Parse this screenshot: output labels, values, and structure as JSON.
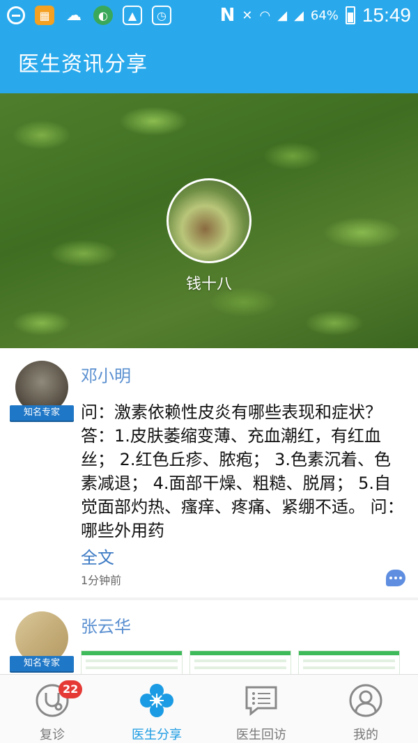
{
  "status_bar": {
    "signal_label": "N",
    "battery_percent": "64%",
    "time": "15:49"
  },
  "app_bar": {
    "title": "医生资讯分享"
  },
  "profile": {
    "name": "钱十八"
  },
  "posts": [
    {
      "author": "邓小明",
      "badge": "知名专家",
      "content": "问：激素依赖性皮炎有哪些表现和症状？ 答：1.皮肤萎缩变薄、充血潮红，有红血丝； 2.红色丘疹、脓疱； 3.色素沉着、色素减退； 4.面部干燥、粗糙、脱屑； 5.自觉面部灼热、瘙痒、疼痛、紧绷不适。 问：哪些外用药",
      "more_label": "全文",
      "time_ago": "1分钟前"
    },
    {
      "author": "张云华",
      "badge": "知名专家"
    }
  ],
  "bottom_nav": {
    "items": [
      {
        "label": "复诊",
        "icon": "stethoscope-icon",
        "badge": "22"
      },
      {
        "label": "医生分享",
        "icon": "flower-icon"
      },
      {
        "label": "医生回访",
        "icon": "chat-list-icon"
      },
      {
        "label": "我的",
        "icon": "user-icon"
      }
    ],
    "active_color": "#1b9be3"
  },
  "colors": {
    "primary": "#29a9ec",
    "author": "#5a8fd0",
    "badge": "#1f77c7"
  }
}
